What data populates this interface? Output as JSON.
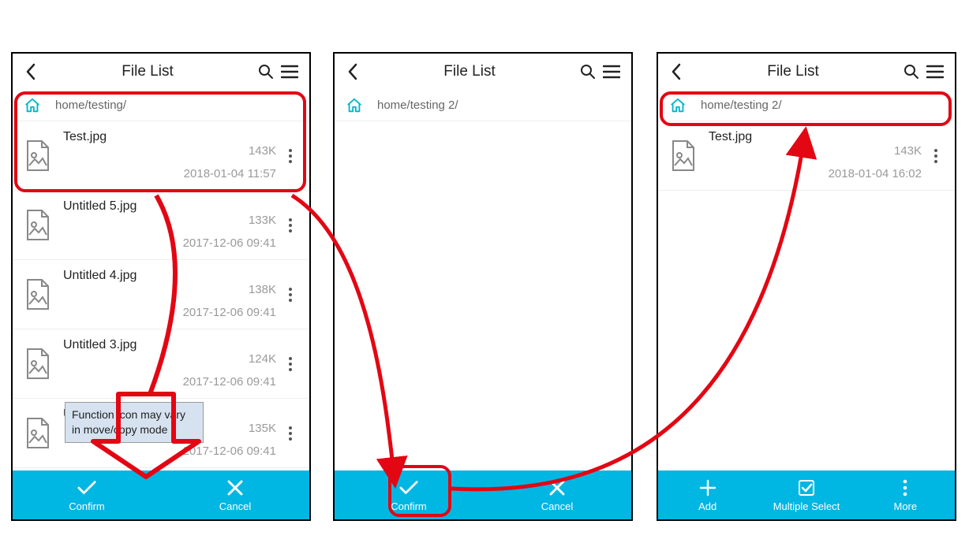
{
  "phone1": {
    "title": "File List",
    "breadcrumb": "home/testing/",
    "files": [
      {
        "name": "Test.jpg",
        "size": "143K",
        "date": "2018-01-04 11:57"
      },
      {
        "name": "Untitled 5.jpg",
        "size": "133K",
        "date": "2017-12-06 09:41"
      },
      {
        "name": "Untitled 4.jpg",
        "size": "138K",
        "date": "2017-12-06 09:41"
      },
      {
        "name": "Untitled 3.jpg",
        "size": "124K",
        "date": "2017-12-06 09:41"
      },
      {
        "name": "Untitled 2.jpg",
        "size": "135K",
        "date": "2017-12-06 09:41"
      }
    ],
    "bar": {
      "confirm": "Confirm",
      "cancel": "Cancel"
    }
  },
  "phone2": {
    "title": "File List",
    "breadcrumb": "home/testing 2/",
    "bar": {
      "confirm": "Confirm",
      "cancel": "Cancel"
    }
  },
  "phone3": {
    "title": "File List",
    "breadcrumb": "home/testing 2/",
    "files": [
      {
        "name": "Test.jpg",
        "size": "143K",
        "date": "2018-01-04 16:02"
      }
    ],
    "bar": {
      "add": "Add",
      "multi": "Multiple Select",
      "more": "More"
    }
  },
  "callout": {
    "line1": "Function icon may vary",
    "line2": "in move/copy mode"
  }
}
